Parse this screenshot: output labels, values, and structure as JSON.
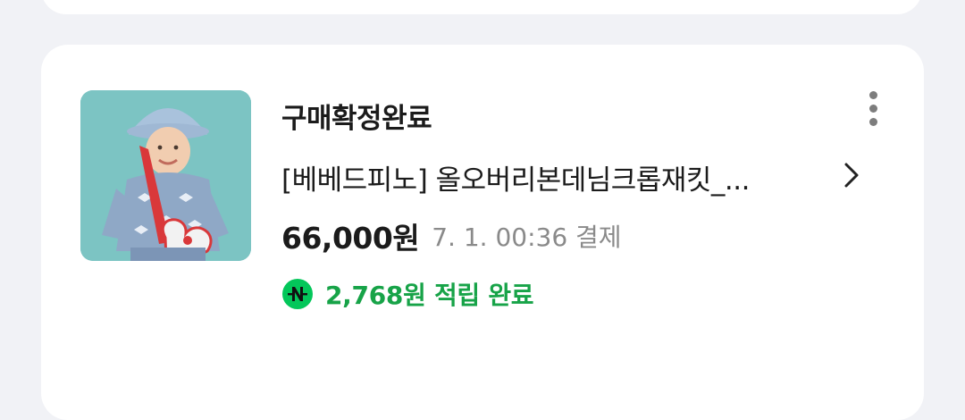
{
  "order": {
    "status": "구매확정완료",
    "product_name": "[베베드피노] 올오버리본데님크롭재킷_...",
    "price": "66,000원",
    "payment_time": "7. 1. 00:36 결제",
    "points": "2,768원 적립 완료",
    "thumbnail_icon": "product-photo",
    "more_icon": "more-vertical-icon",
    "chevron_icon": "chevron-right-icon",
    "points_icon": "naver-pay-icon"
  },
  "colors": {
    "background": "#f1f2f6",
    "card": "#ffffff",
    "points_green": "#17a348",
    "badge_green": "#03c75a",
    "thumb_bg": "#7cc4c3"
  }
}
